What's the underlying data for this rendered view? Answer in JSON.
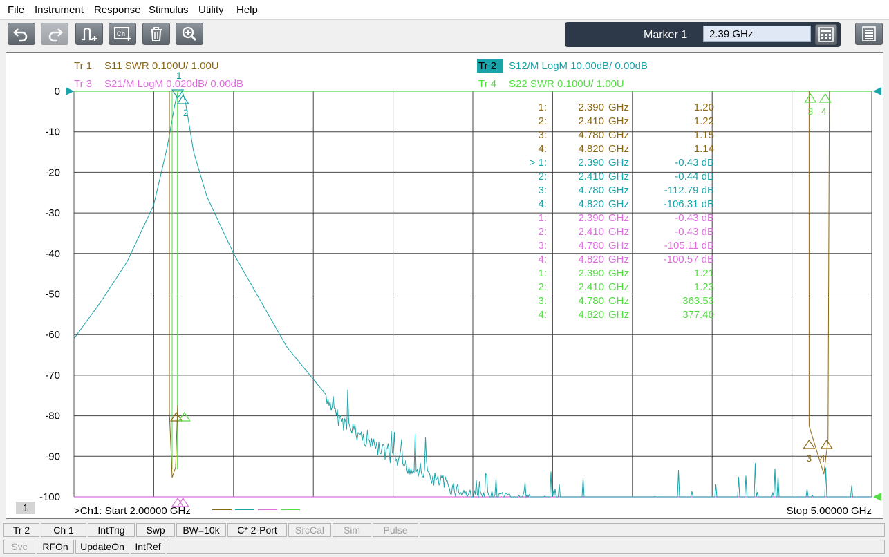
{
  "menu": [
    "File",
    "Instrument",
    "Response",
    "Stimulus",
    "Utility",
    "Help"
  ],
  "toolbar": {
    "buttons": [
      "undo-icon",
      "redo-icon",
      "add-trace-icon",
      "add-channel-icon",
      "delete-icon",
      "zoom-icon"
    ],
    "marker_label": "Marker 1",
    "marker_value": "2.39 GHz"
  },
  "traces": [
    {
      "id": "tr1",
      "tr": "Tr  1",
      "desc": "S11 SWR 0.100U/  1.00U",
      "color": "#8b6914",
      "active": false
    },
    {
      "id": "tr2",
      "tr": "Tr  2",
      "desc": "S12/M LogM 10.00dB/  0.00dB",
      "color": "#1aa3a8",
      "active": true
    },
    {
      "id": "tr3",
      "tr": "Tr  3",
      "desc": "S21/M LogM 0.020dB/  0.00dB",
      "color": "#dd6fdd",
      "active": false
    },
    {
      "id": "tr4",
      "tr": "Tr  4",
      "desc": "S22 SWR 0.100U/  1.00U",
      "color": "#55dd44",
      "active": false
    }
  ],
  "y_ticks": [
    "0",
    "-10",
    "-20",
    "-30",
    "-40",
    "-50",
    "-60",
    "-70",
    "-80",
    "-90",
    "-100"
  ],
  "marker_table": [
    {
      "num": "1:",
      "freq": "2.390",
      "unit": "GHz",
      "val": "1.20",
      "trace": "tr1"
    },
    {
      "num": "2:",
      "freq": "2.410",
      "unit": "GHz",
      "val": "1.22",
      "trace": "tr1"
    },
    {
      "num": "3:",
      "freq": "4.780",
      "unit": "GHz",
      "val": "1.15",
      "trace": "tr1"
    },
    {
      "num": "4:",
      "freq": "4.820",
      "unit": "GHz",
      "val": "1.14",
      "trace": "tr1"
    },
    {
      "num": "> 1:",
      "freq": "2.390",
      "unit": "GHz",
      "val": "-0.43 dB",
      "trace": "tr2"
    },
    {
      "num": "2:",
      "freq": "2.410",
      "unit": "GHz",
      "val": "-0.44 dB",
      "trace": "tr2"
    },
    {
      "num": "3:",
      "freq": "4.780",
      "unit": "GHz",
      "val": "-112.79 dB",
      "trace": "tr2"
    },
    {
      "num": "4:",
      "freq": "4.820",
      "unit": "GHz",
      "val": "-106.31 dB",
      "trace": "tr2"
    },
    {
      "num": "1:",
      "freq": "2.390",
      "unit": "GHz",
      "val": "-0.43 dB",
      "trace": "tr3"
    },
    {
      "num": "2:",
      "freq": "2.410",
      "unit": "GHz",
      "val": "-0.43 dB",
      "trace": "tr3"
    },
    {
      "num": "3:",
      "freq": "4.780",
      "unit": "GHz",
      "val": "-105.11 dB",
      "trace": "tr3"
    },
    {
      "num": "4:",
      "freq": "4.820",
      "unit": "GHz",
      "val": "-100.57 dB",
      "trace": "tr3"
    },
    {
      "num": "1:",
      "freq": "2.390",
      "unit": "GHz",
      "val": "1.21",
      "trace": "tr4"
    },
    {
      "num": "2:",
      "freq": "2.410",
      "unit": "GHz",
      "val": "1.23",
      "trace": "tr4"
    },
    {
      "num": "3:",
      "freq": "4.780",
      "unit": "GHz",
      "val": "363.53",
      "trace": "tr4"
    },
    {
      "num": "4:",
      "freq": "4.820",
      "unit": "GHz",
      "val": "377.40",
      "trace": "tr4"
    }
  ],
  "channel_box": "1",
  "start_label": ">Ch1:  Start   2.00000 GHz",
  "stop_label": "Stop  5.00000 GHz",
  "marker_tags": [
    "1",
    "2",
    "3",
    "4"
  ],
  "status_row1": [
    {
      "label": "Tr 2",
      "enabled": true
    },
    {
      "label": "Ch 1",
      "enabled": true
    },
    {
      "label": "IntTrig",
      "enabled": true
    },
    {
      "label": "Swp",
      "enabled": true
    },
    {
      "label": "BW=10k",
      "enabled": true
    },
    {
      "label": "C* 2-Port",
      "enabled": true
    },
    {
      "label": "SrcCal",
      "enabled": false
    },
    {
      "label": "Sim",
      "enabled": false
    },
    {
      "label": "Pulse",
      "enabled": false
    }
  ],
  "status_row2": [
    {
      "label": "Svc",
      "enabled": false
    },
    {
      "label": "RFOn",
      "enabled": true
    },
    {
      "label": "UpdateOn",
      "enabled": true
    },
    {
      "label": "IntRef",
      "enabled": true
    }
  ],
  "chart_data": {
    "type": "line",
    "x_start_ghz": 2.0,
    "x_stop_ghz": 5.0,
    "ylim": [
      -100,
      0
    ],
    "grid": true,
    "series": [
      {
        "name": "S12/M LogM",
        "trace": "tr2",
        "x": [
          2.0,
          2.1,
          2.2,
          2.3,
          2.35,
          2.38,
          2.39,
          2.41,
          2.42,
          2.45,
          2.5,
          2.6,
          2.8,
          3.0,
          3.2,
          3.5,
          3.8,
          4.0,
          4.5,
          4.78,
          4.82,
          5.0
        ],
        "y": [
          -61,
          -52,
          -42,
          -28,
          -14,
          -3,
          -0.43,
          -0.44,
          -3,
          -15,
          -26,
          -40,
          -63,
          -79,
          -89,
          -98,
          -100,
          -100,
          -100,
          -100,
          -100,
          -100
        ]
      },
      {
        "name": "S11 SWR",
        "trace": "tr1",
        "x": [
          2.0,
          2.38,
          2.39,
          2.41,
          2.42,
          4.77,
          4.78,
          4.82,
          4.83,
          5.0
        ],
        "y": [
          null,
          null,
          1.2,
          1.22,
          null,
          null,
          1.15,
          1.14,
          null,
          null
        ]
      },
      {
        "name": "S22 SWR",
        "trace": "tr4",
        "x": [
          2.0,
          2.39,
          2.41,
          4.78,
          4.82,
          5.0
        ],
        "y": [
          null,
          1.21,
          1.23,
          363.53,
          377.4,
          null
        ]
      },
      {
        "name": "S21/M LogM",
        "trace": "tr3",
        "x": [
          2.0,
          2.39,
          2.41,
          4.78,
          4.82,
          5.0
        ],
        "y": [
          null,
          -0.43,
          -0.43,
          -105.11,
          -100.57,
          null
        ]
      }
    ]
  }
}
